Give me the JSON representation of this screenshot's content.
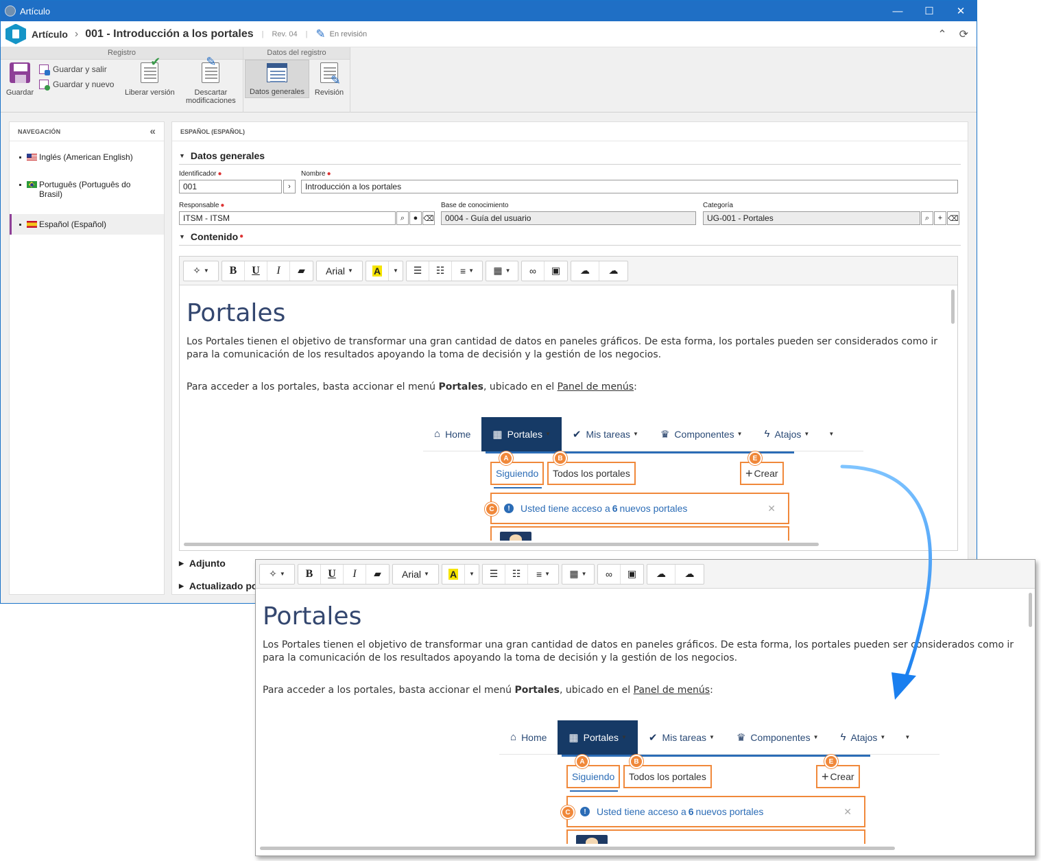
{
  "window": {
    "title": "Artículo",
    "controls": {
      "minimize": "—",
      "maximize": "☐",
      "close": "✕"
    }
  },
  "header": {
    "crumb_root": "Artículo",
    "separator": "›",
    "crumb_title": "001 - Introducción a los portales",
    "pipe": "|",
    "revision": "Rev. 04",
    "status": "En revisión"
  },
  "ribbon": {
    "group_registro": "Registro",
    "group_datos": "Datos del registro",
    "guardar": "Guardar",
    "guardar_salir": "Guardar y salir",
    "guardar_nuevo": "Guardar y nuevo",
    "liberar": "Liberar versión",
    "descartar_1": "Descartar",
    "descartar_2": "modificaciones",
    "datos_generales": "Datos generales",
    "revision": "Revisión"
  },
  "nav": {
    "title": "NAVEGACIÓN",
    "items": [
      {
        "label": "Inglés (American English)"
      },
      {
        "label_1": "Português (Português do",
        "label_2": "Brasil)"
      },
      {
        "label": "Español (Español)"
      }
    ]
  },
  "main": {
    "title": "ESPAÑOL (ESPAÑOL)",
    "sec_datos": "Datos generales",
    "identificador_label": "Identificador",
    "identificador_value": "001",
    "nombre_label": "Nombre",
    "nombre_value": "Introducción a los portales",
    "responsable_label": "Responsable",
    "responsable_value": "ITSM - ITSM",
    "base_label": "Base de conocimiento",
    "base_value": "0004 - Guía del usuario",
    "categoria_label": "Categoría",
    "categoria_value": "UG-001 - Portales",
    "sec_contenido": "Contenido",
    "sec_adjunto": "Adjunto",
    "sec_actualizado": "Actualizado po"
  },
  "toolbar": {
    "font": "Arial",
    "bold": "B",
    "underline": "U",
    "italic": "I",
    "highlight": "A"
  },
  "content": {
    "heading": "Portales",
    "para1_line1": "Los Portales tienen el objetivo de transformar una gran cantidad de datos en paneles gráficos. De esta forma, los portales pueden ser considerados como ir",
    "para1_line2": "para la comunicación de los resultados apoyando la toma de decisión y la gestión de los negocios.",
    "para2_pre": "Para acceder a los portales, basta accionar el menú ",
    "para2_bold": "Portales",
    "para2_mid": ", ubicado en el ",
    "para2_link": "Panel de menús",
    "para2_post": ":"
  },
  "menu_image": {
    "items": [
      "Home",
      "Portales",
      "Mis tareas",
      "Componentes",
      "Atajos"
    ],
    "tab_following": "Siguiendo",
    "tab_all": "Todos los portales",
    "create": "Crear",
    "notice_pre": "Usted tiene acceso a ",
    "notice_count": "6",
    "notice_post": " nuevos portales",
    "badges": {
      "a": "A",
      "b": "B",
      "c": "C",
      "e": "E"
    }
  },
  "colors": {
    "titlebar": "#1f6fc5",
    "accent_purple": "#8e3f97",
    "callout_orange": "#f0883a",
    "menu_active": "#163a66",
    "arrow_blue": "#1a8cff"
  }
}
